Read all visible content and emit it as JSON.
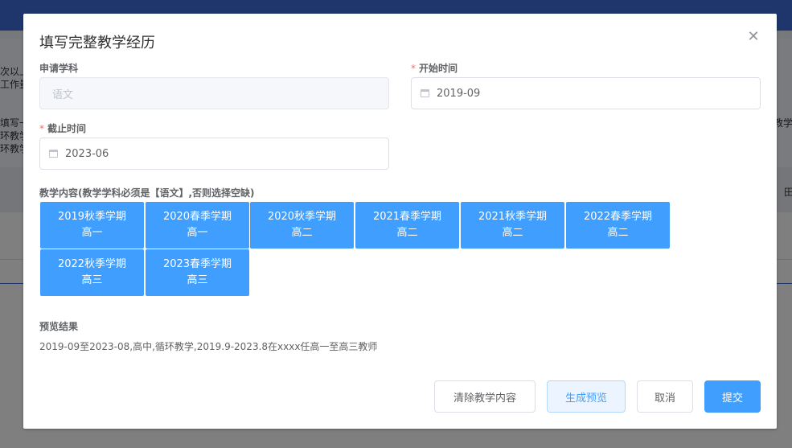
{
  "background": {
    "fragments": [
      "次以上",
      "工作量",
      "填写一",
      "环教学",
      "环教学",
      "教学",
      "田"
    ]
  },
  "dialog": {
    "title": "填写完整教学经历",
    "close_icon": "close-icon",
    "subject": {
      "label": "申请学科",
      "value": "语文"
    },
    "start_time": {
      "required_mark": "*",
      "label": "开始时间",
      "value": "2019-09"
    },
    "end_time": {
      "required_mark": "*",
      "label": "截止时间",
      "value": "2023-06"
    },
    "teaching_content": {
      "label": "教学内容(教学学科必须是【语文】,否则选择空缺)",
      "terms": [
        {
          "term": "2019秋季学期",
          "grade": "高一"
        },
        {
          "term": "2020春季学期",
          "grade": "高一"
        },
        {
          "term": "2020秋季学期",
          "grade": "高二"
        },
        {
          "term": "2021春季学期",
          "grade": "高二"
        },
        {
          "term": "2021秋季学期",
          "grade": "高二"
        },
        {
          "term": "2022春季学期",
          "grade": "高二"
        },
        {
          "term": "2022秋季学期",
          "grade": "高三"
        },
        {
          "term": "2023春季学期",
          "grade": "高三"
        }
      ]
    },
    "preview": {
      "label": "预览结果",
      "text": "2019-09至2023-08,高中,循环教学,2019.9-2023.8在xxxx任高一至高三教师"
    },
    "buttons": {
      "clear": "清除教学内容",
      "generate": "生成预览",
      "cancel": "取消",
      "submit": "提交"
    }
  },
  "colors": {
    "primary": "#409eff",
    "required": "#f56c6c",
    "header": "#3d6cd6"
  }
}
